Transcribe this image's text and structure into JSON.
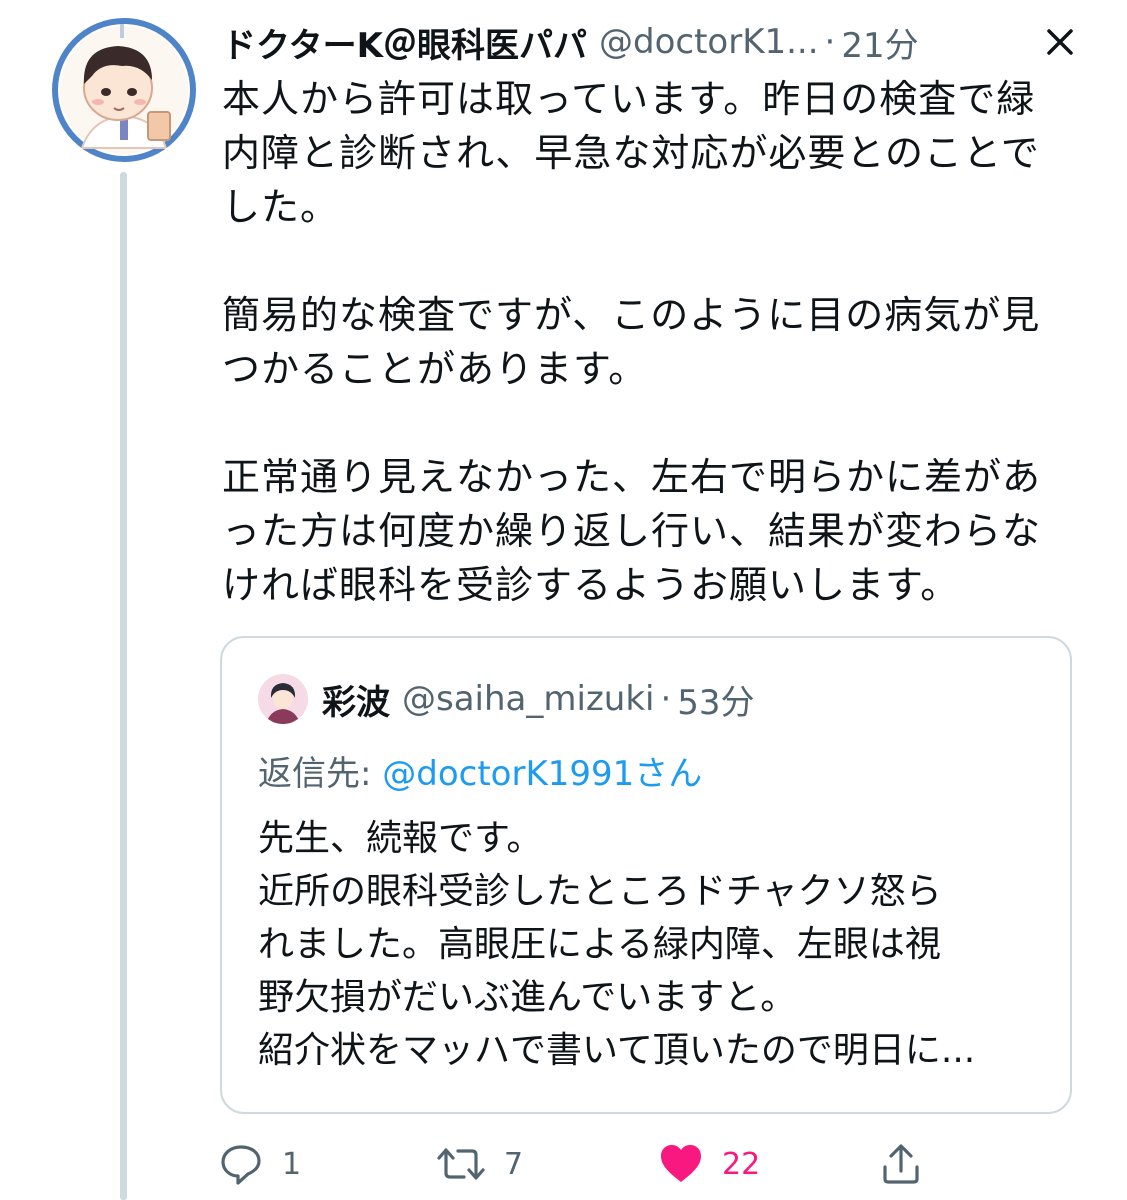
{
  "tweet": {
    "display_name": "ドクターK＠眼科医パパ",
    "handle": "@doctorK1...",
    "separator": "·",
    "time": "21分",
    "paragraphs": [
      "本人から許可は取っています。昨日の検査で緑内障と診断され、早急な対応が必要とのことでした。",
      "簡易的な検査ですが、このように目の病気が見つかることがあります。",
      "正常通り見えなかった、左右で明らかに差があった方は何度か繰り返し行い、結果が変わらなければ眼科を受診するようお願いします。"
    ]
  },
  "quote": {
    "display_name": "彩波",
    "handle": "@saiha_mizuki",
    "separator": "·",
    "time": "53分",
    "reply_prefix": "返信先: ",
    "reply_mention": "@doctorK1991",
    "reply_suffix": "さん",
    "lines": [
      "先生、続報です。",
      "近所の眼科受診したところドチャクソ怒ら",
      "れました。高眼圧による緑内障、左眼は視",
      "野欠損がだいぶ進んでいますと。",
      "紹介状をマッハで書いて頂いたので明日に..."
    ]
  },
  "actions": {
    "reply_count": "1",
    "retweet_count": "7",
    "like_count": "22"
  },
  "icons": {
    "close": "close-icon",
    "reply": "reply-icon",
    "retweet": "retweet-icon",
    "like": "heart-icon",
    "share": "share-icon"
  },
  "colors": {
    "text": "#0f1419",
    "secondary": "#536471",
    "link": "#1d9bf0",
    "like": "#f91880",
    "border": "#cfd9de",
    "avatar_ring": "#4f84c9"
  }
}
